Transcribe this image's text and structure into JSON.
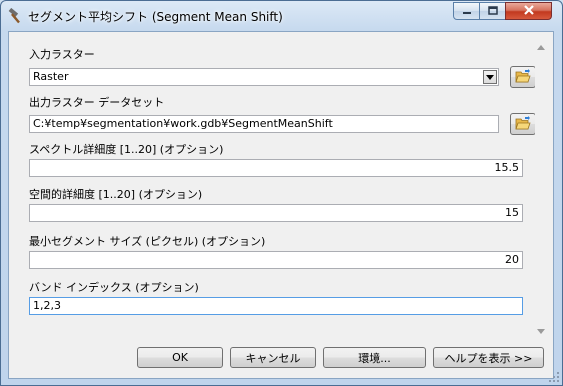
{
  "window": {
    "title": "セグメント平均シフト (Segment Mean Shift)"
  },
  "form": {
    "input_raster": {
      "label": "入力ラスター",
      "value": "Raster"
    },
    "output_dataset": {
      "label": "出力ラスター データセット",
      "value": "C:¥temp¥segmentation¥work.gdb¥SegmentMeanShift"
    },
    "spectral_detail": {
      "label": "スペクトル詳細度 [1..20] (オプション)",
      "value": "15.5"
    },
    "spatial_detail": {
      "label": "空間的詳細度 [1..20] (オプション)",
      "value": "15"
    },
    "min_segment_size": {
      "label": "最小セグメント サイズ (ピクセル) (オプション)",
      "value": "20"
    },
    "band_indexes": {
      "label": "バンド インデックス (オプション)",
      "value": "1,2,3"
    }
  },
  "buttons": {
    "ok": "OK",
    "cancel": "キャンセル",
    "environments": "環境...",
    "show_help": "ヘルプを表示 >>"
  },
  "icons": {
    "app": "hammer-icon",
    "browse": "open-folder-icon",
    "dropdown": "chevron-down-icon"
  }
}
